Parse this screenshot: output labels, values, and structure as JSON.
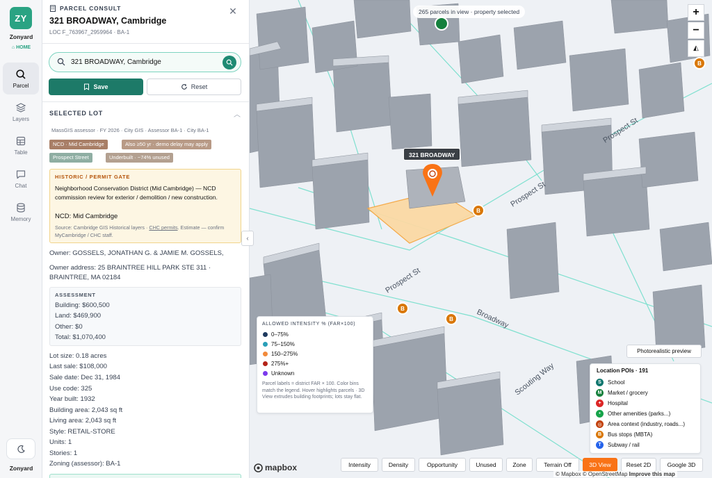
{
  "rail": {
    "logo": "ZY",
    "brand": "Zonyard",
    "home": "HOME",
    "items": [
      {
        "label": "Parcel",
        "icon": "search-icon"
      },
      {
        "label": "Layers",
        "icon": "layers-icon"
      },
      {
        "label": "Table",
        "icon": "table-icon"
      },
      {
        "label": "Chat",
        "icon": "chat-icon"
      },
      {
        "label": "Memory",
        "icon": "database-icon"
      }
    ],
    "footer": "Zonyard"
  },
  "panel": {
    "eyebrow": "PARCEL CONSULT",
    "title": "321 BROADWAY, Cambridge",
    "subtitle": "LOC F_763967_2959964 · BA-1",
    "search_value": "321 BROADWAY, Cambridge",
    "save_label": "Save",
    "reset_label": "Reset",
    "section_title": "SELECTED LOT",
    "source_line": "MassGIS assessor · FY 2026 · City GIS · Assessor BA-1 · City BA-1",
    "tags": [
      {
        "label": "NCD · Mid Cambridge",
        "color": "#a87e66"
      },
      {
        "label": "Also ≥50 yr · demo delay may apply",
        "color": "#b89a86"
      },
      {
        "label": "Prospect Street",
        "color": "#8faea3"
      },
      {
        "label": "Underbuilt · ~74% unused",
        "color": "#b3a090"
      }
    ],
    "gate": {
      "title": "HISTORIC / PERMIT GATE",
      "body": "Neighborhood Conservation District (Mid Cambridge) — NCD commission review for exterior / demolition / new construction.",
      "ncd": "NCD: Mid Cambridge",
      "source_prefix": "Source: Cambridge GIS Historical layers · ",
      "source_link": "CHC permits",
      "source_suffix": ". Estimate — confirm MyCambridge / CHC staff."
    },
    "owner": "Owner: GOSSELS, JONATHAN G. & JAMIE M. GOSSELS,",
    "owner_address_1": "Owner address: 25 BRAINTREE HILL PARK STE 311 ·",
    "owner_address_2": "BRAINTREE, MA 02184",
    "assessment": {
      "title": "ASSESSMENT",
      "building": "Building: $600,500",
      "land": "Land: $469,900",
      "other": "Other: $0",
      "total": "Total: $1,070,400"
    },
    "facts": [
      "Lot size: 0.18 acres",
      "Last sale: $108,000",
      "Sale date: Dec 31, 1984",
      "Use code: 325",
      "Year built: 1932",
      "Building area: 2,043 sq ft",
      "Living area: 2,043 sq ft",
      "Style: RETAIL-STORE",
      "Units: 1",
      "Stories: 1",
      "Zoning (assessor): BA-1"
    ]
  },
  "map": {
    "status": "265 parcels in view · property selected",
    "selected_label": "321 BROADWAY",
    "streets": [
      "Prospect St",
      "Prospect St",
      "Prospect St",
      "Broadway",
      "Scouting Way"
    ],
    "legend": {
      "title": "ALLOWED INTENSITY % (FAR×100)",
      "items": [
        {
          "label": "0–75%",
          "color": "#1e3a5f"
        },
        {
          "label": "75–150%",
          "color": "#2a9fb8"
        },
        {
          "label": "150–275%",
          "color": "#f28a3b"
        },
        {
          "label": "275%+",
          "color": "#b42318"
        },
        {
          "label": "Unknown",
          "color": "#7c3aed"
        }
      ],
      "note": "Parcel labels = district FAR × 100. Color bins match the legend. Hover highlights parcels · 3D View extrudes building footprints; lots stay flat."
    },
    "photo_button": "Photorealistic preview",
    "poi": {
      "title": "Location POIs · 191",
      "items": [
        {
          "label": "School",
          "color": "#0f766e",
          "glyph": "S"
        },
        {
          "label": "Market / grocery",
          "color": "#15803d",
          "glyph": "M"
        },
        {
          "label": "Hospital",
          "color": "#dc2626",
          "glyph": "+"
        },
        {
          "label": "Other amenities (parks...)",
          "color": "#16a34a",
          "glyph": "•"
        },
        {
          "label": "Area context (industry, roads...)",
          "color": "#c2410c",
          "glyph": "◎"
        },
        {
          "label": "Bus stops (MBTA)",
          "color": "#d97706",
          "glyph": "B"
        },
        {
          "label": "Subway / rail",
          "color": "#2563eb",
          "glyph": "T"
        }
      ]
    },
    "modes": [
      "Intensity",
      "Density",
      "Opportunity",
      "Unused",
      "Zone",
      "Terrain Off",
      "3D View",
      "Reset 2D",
      "Google 3D"
    ],
    "active_mode": "3D View",
    "bus_marker": "B",
    "attribution_prefix": "© Mapbox © OpenStreetMap ",
    "attribution_link": "Improve this map",
    "mapbox_logo": "mapbox",
    "accent": "#f97316"
  }
}
